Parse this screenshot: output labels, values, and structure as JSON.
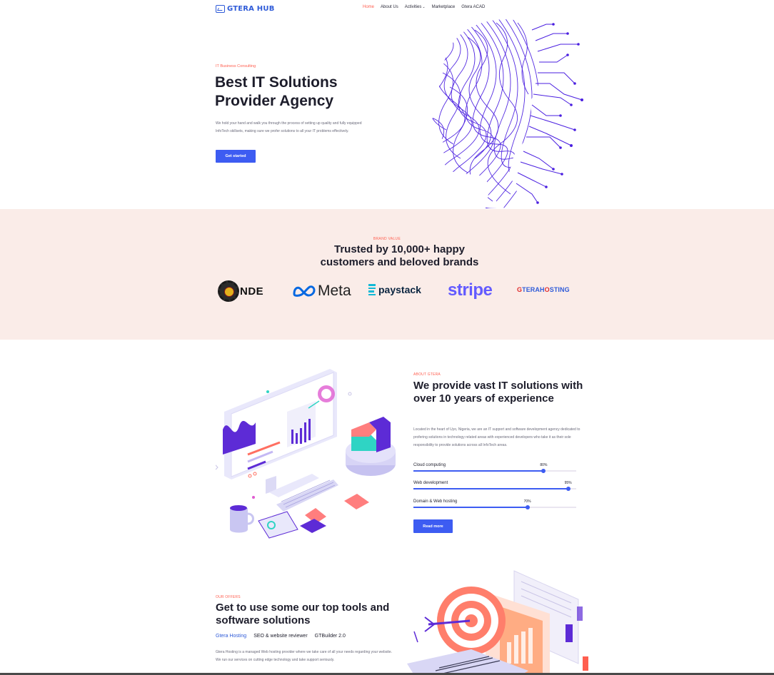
{
  "nav": {
    "logo_text": "GTERA HUB",
    "items": [
      {
        "label": "Home",
        "active": true
      },
      {
        "label": "About Us"
      },
      {
        "label": "Activities",
        "has_dropdown": true
      },
      {
        "label": "Marketplace"
      },
      {
        "label": "Gtera ACAD"
      }
    ]
  },
  "hero": {
    "tag": "IT Business Consulting",
    "title": "Best IT Solutions Provider Agency",
    "description": "We hold your hand and walk you through the process of setting up quality and fully equipped InfoTech skillsets, making sure we profer solutions to all your IT problems effectively.",
    "cta_label": "Get started"
  },
  "brands": {
    "tag": "BRAND VALUE",
    "title_line1": "Trusted by 10,000+ happy",
    "title_line2": "customers and beloved brands",
    "logos": {
      "nde": "NDE",
      "meta": "Meta",
      "paystack": "paystack",
      "stripe": "stripe",
      "gtera_hosting_prefix": "G",
      "gtera_hosting_mid": "TERAH",
      "gtera_hosting_o": "O",
      "gtera_hosting_suffix": "STING"
    }
  },
  "about": {
    "tag": "ABOUT GTERA",
    "title": "We provide vast IT solutions with over 10 years of experience",
    "description": "Located in the heart of Uyo, Nigeria, we are an IT support and software development agency dedicated to profering solutions in technology related areas with experienced developers who take it as their sole responsibility to provide solutions across all InfoTech areas.",
    "skills": [
      {
        "label": "Cloud computing",
        "percent_label": "80%",
        "value": 0.8
      },
      {
        "label": "Web development",
        "percent_label": "95%",
        "value": 0.95
      },
      {
        "label": "Domain & Web hosting",
        "percent_label": "70%",
        "value": 0.7
      }
    ],
    "cta_label": "Read more"
  },
  "offers": {
    "tag": "OUR OFFERS",
    "title": "Get to use some our top tools and software solutions",
    "tabs": [
      {
        "label": "Gtera Hosting",
        "selected": true
      },
      {
        "label": "SEO & website reviewer"
      },
      {
        "label": "GTBuilder 2.0"
      }
    ],
    "description": "Gtera Hosting is a managed Web hosting provider where we take care of all your needs regarding your website. We run our services on cutting edge technology and take support seriously."
  },
  "colors": {
    "accent": "#ff5e4f",
    "primary": "#3d5cf2",
    "brand_band": "#faece8",
    "head_art": "#4a1fe0"
  }
}
